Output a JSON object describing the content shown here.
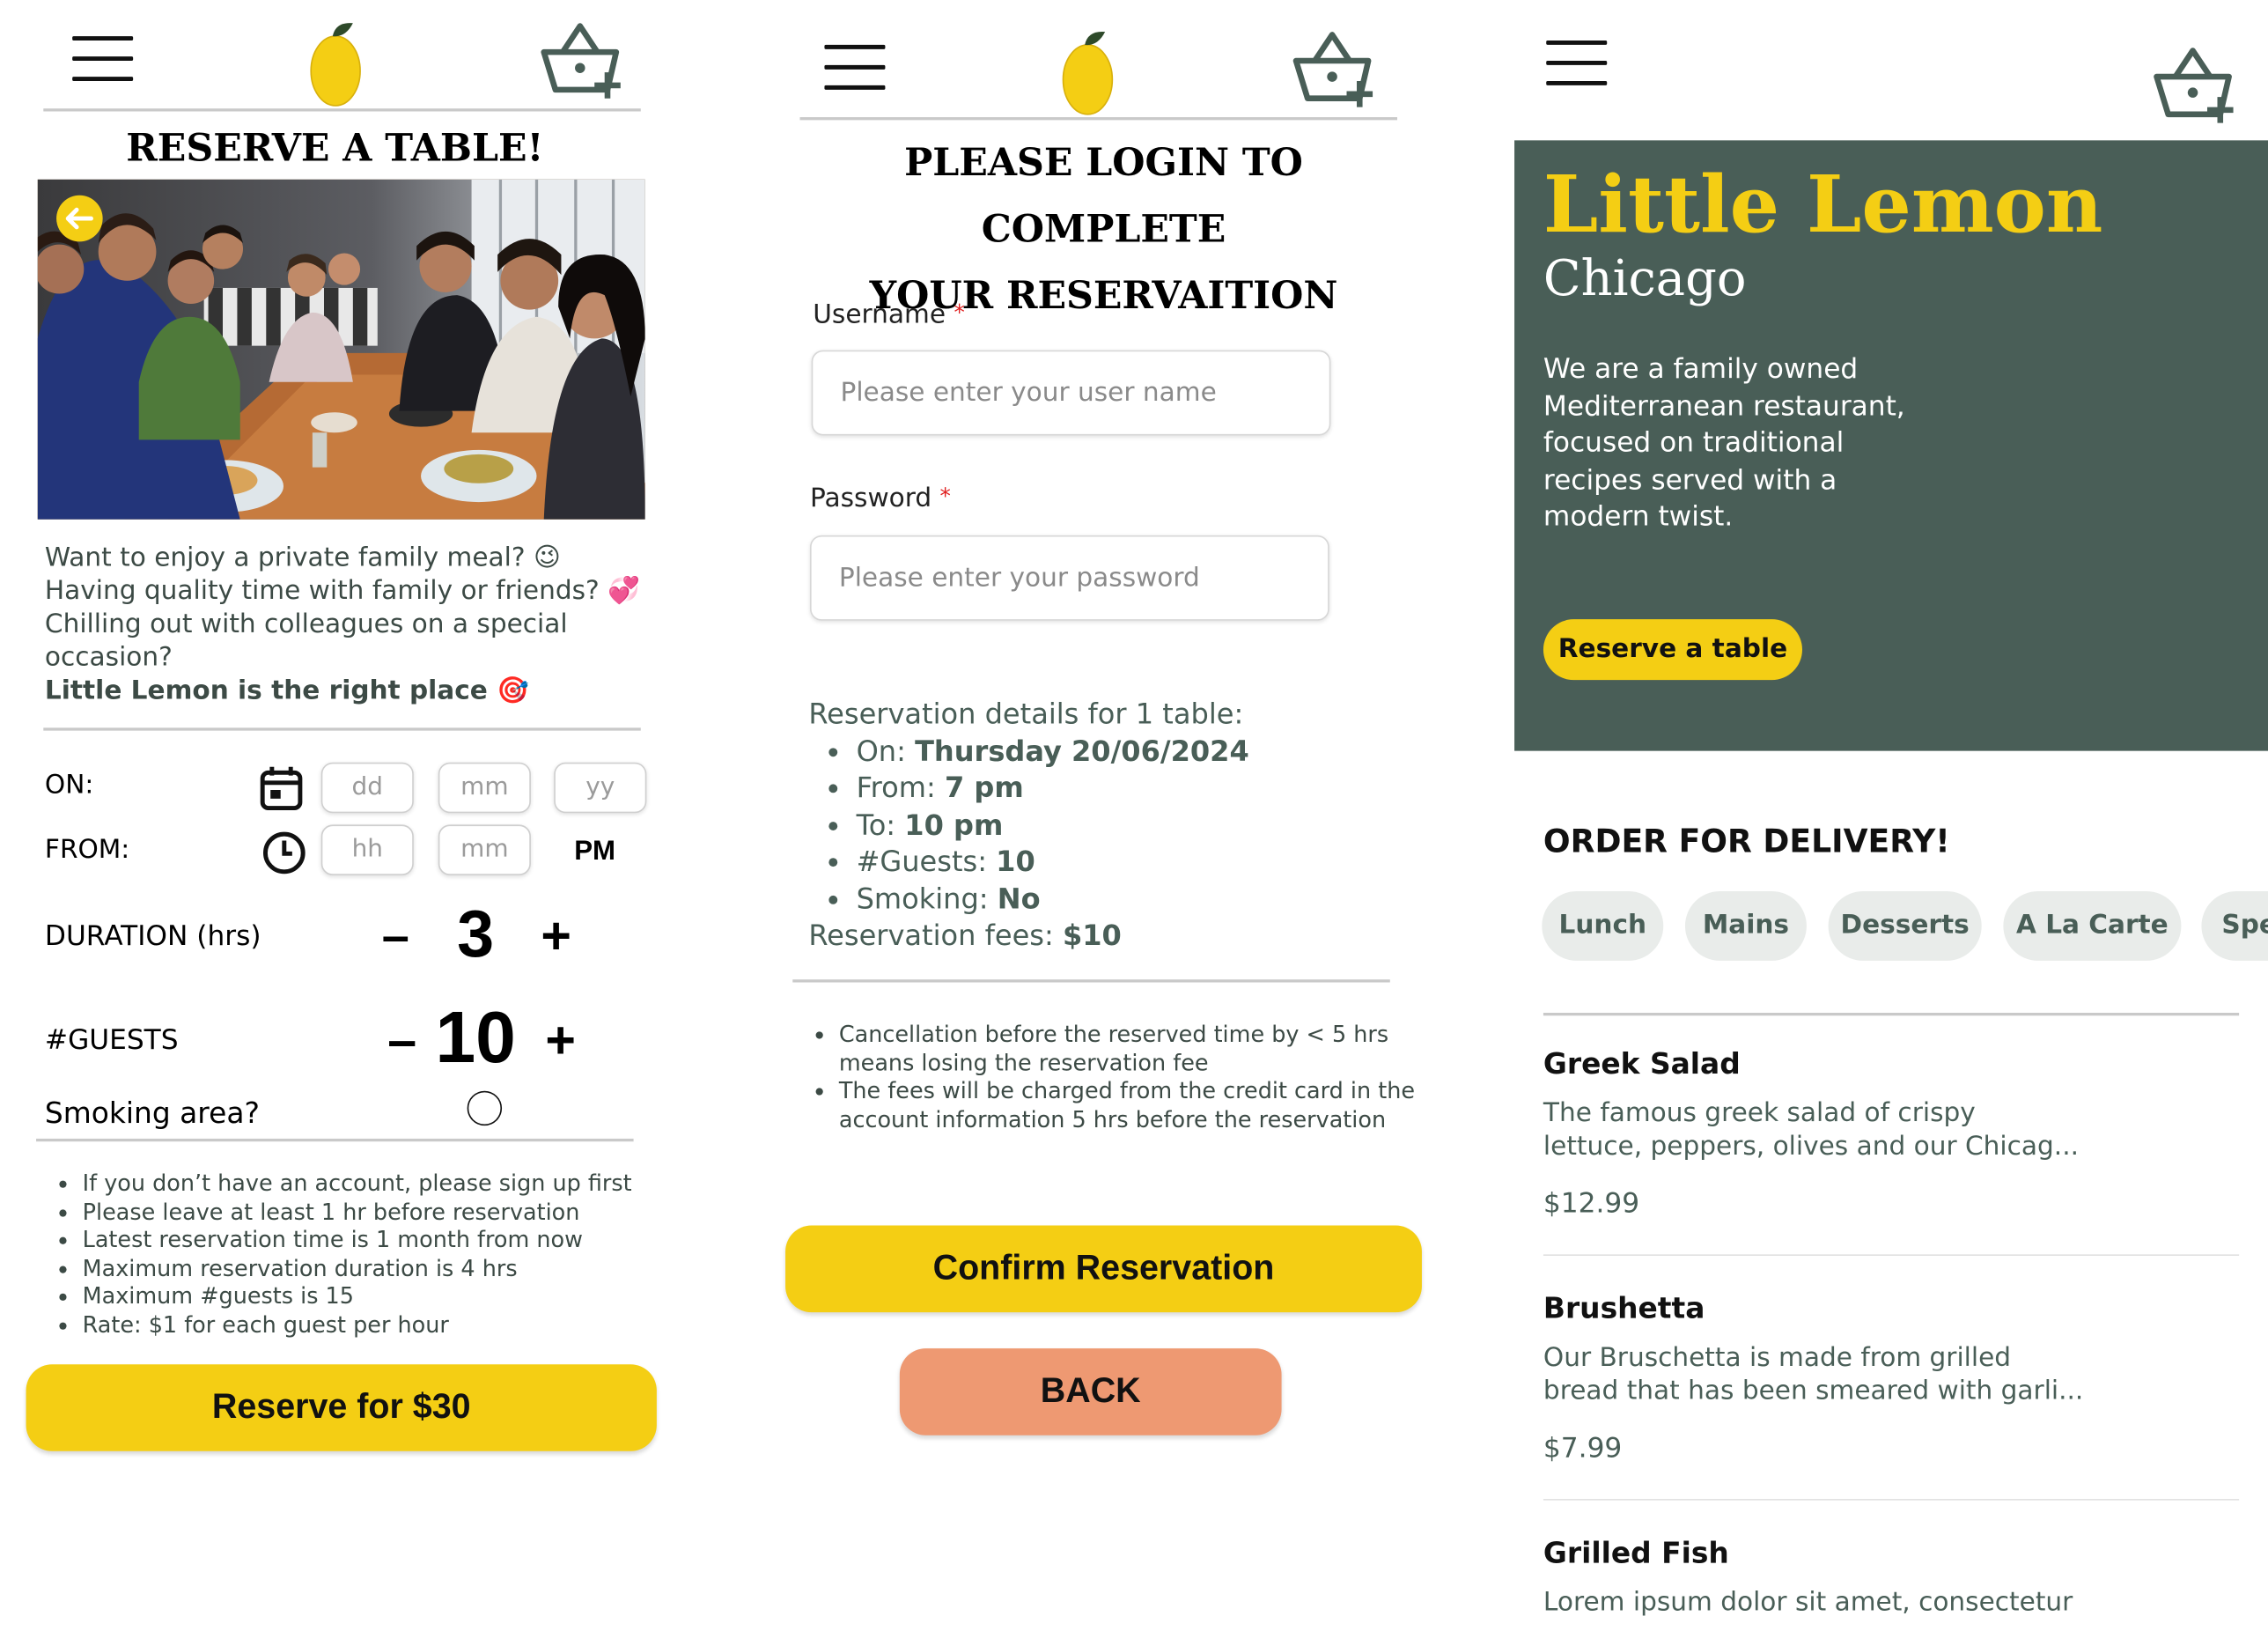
{
  "colors": {
    "primary_green": "#495e57",
    "primary_yellow": "#f4ce14",
    "back_button": "#ee9972",
    "required_star": "#e01f1f"
  },
  "icons": {
    "menu": "hamburger-icon",
    "logo": "lemon-icon",
    "basket": "basket-add-icon",
    "back_arrow": "arrow-left-icon",
    "calendar": "calendar-icon",
    "clock": "clock-icon"
  },
  "screen1": {
    "title": "RESERVE A TABLE!",
    "intro": {
      "line1": "Want to enjoy a private family meal? 😉",
      "line2": "Having quality time with family or friends? 💞",
      "line3": "Chilling out with colleagues on a special",
      "line4": "occasion?",
      "line5": "Little Lemon is the right place 🎯"
    },
    "on_label": "ON:",
    "date_placeholders": {
      "day": "dd",
      "month": "mm",
      "year": "yy"
    },
    "from_label": "FROM:",
    "time_placeholders": {
      "hour": "hh",
      "minute": "mm"
    },
    "ampm": "PM",
    "duration_label": "DURATION (hrs)",
    "duration_value": "3",
    "guests_label": "#GUESTS",
    "guests_value": "10",
    "minus": "–",
    "plus": "+",
    "smoking_label": "Smoking area?",
    "notes": [
      "If you don’t have an account, please sign up first",
      "Please leave at least 1 hr before reservation",
      "Latest reservation time is 1 month from now",
      "Maximum reservation duration is 4 hrs",
      "Maximum #guests is 15",
      "Rate: $1 for each guest per hour"
    ],
    "reserve_button": "Reserve for $30"
  },
  "screen2": {
    "title_line1": "PLEASE LOGIN TO COMPLETE",
    "title_line2": "YOUR RESERVAITION",
    "username_label": "Username",
    "username_placeholder": "Please enter your user name",
    "password_label": "Password",
    "password_placeholder": "Please enter your password",
    "required_mark": "*",
    "details_heading": "Reservation details for 1 table:",
    "details": [
      {
        "label": "On: ",
        "value": "Thursday 20/06/2024"
      },
      {
        "label": "From: ",
        "value": "7 pm"
      },
      {
        "label": "To: ",
        "value": "10 pm"
      },
      {
        "label": "#Guests: ",
        "value": "10"
      },
      {
        "label": "Smoking: ",
        "value": "No"
      }
    ],
    "fees_label": "Reservation fees: ",
    "fees_value": "$10",
    "notes": [
      "Cancellation before the reserved time by < 5 hrs means losing the reservation fee",
      "The fees will be charged from the credit card in the account information 5 hrs before the reservation"
    ],
    "confirm_button": "Confirm Reservation",
    "back_button": "BACK"
  },
  "screen3": {
    "hero_title": "Little Lemon",
    "hero_city": "Chicago",
    "hero_desc_lines": [
      "We are a family owned",
      "Mediterranean restaurant,",
      "focused on traditional",
      "recipes served with a",
      "modern twist."
    ],
    "reserve_button": "Reserve a table",
    "order_heading": "ORDER FOR DELIVERY!",
    "categories": [
      "Lunch",
      "Mains",
      "Desserts",
      "A La Carte",
      "Specials"
    ],
    "menu": [
      {
        "name": "Greek Salad",
        "desc1": "The famous greek salad of crispy",
        "desc2": "lettuce, peppers, olives and our Chicag...",
        "price": "$12.99"
      },
      {
        "name": "Brushetta",
        "desc1": "Our Bruschetta is made from grilled",
        "desc2": "bread that has been smeared with garli...",
        "price": "$7.99"
      },
      {
        "name": "Grilled Fish",
        "desc1": "Lorem ipsum dolor sit amet, consectetur",
        "desc2": "",
        "price": ""
      }
    ]
  }
}
